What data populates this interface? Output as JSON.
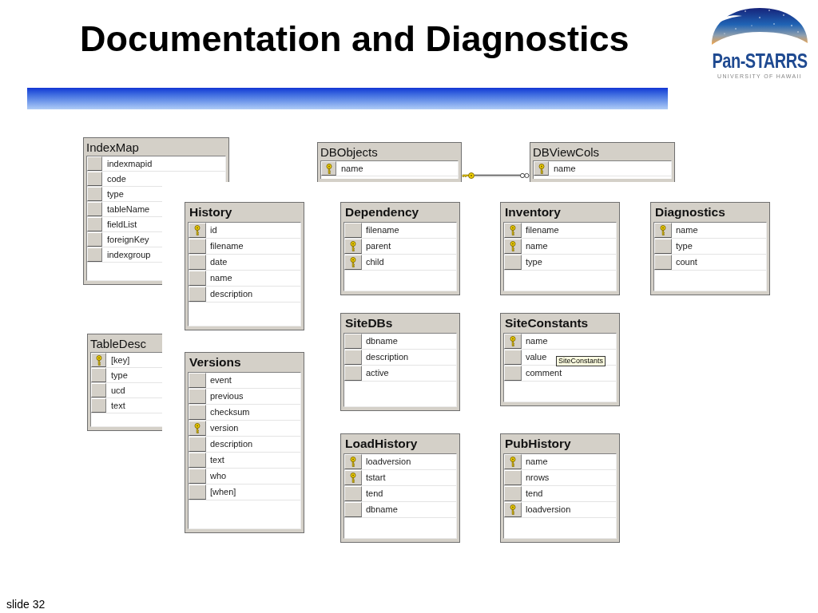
{
  "slide": {
    "title": "Documentation and Diagnostics",
    "footer": "slide 32"
  },
  "logo": {
    "wordmark": "Pan-STARRS",
    "subtitle": "UNIVERSITY OF HAWAII"
  },
  "diagram": {
    "tables": [
      {
        "name": "IndexMap",
        "kind": "plain",
        "columns": [
          {
            "name": "indexmapid",
            "key": false
          },
          {
            "name": "code",
            "key": false
          },
          {
            "name": "type",
            "key": false
          },
          {
            "name": "tableName",
            "key": false
          },
          {
            "name": "fieldList",
            "key": false
          },
          {
            "name": "foreignKey",
            "key": false
          },
          {
            "name": "indexgroup",
            "key": false
          }
        ]
      },
      {
        "name": "DBObjects",
        "kind": "plain",
        "columns": [
          {
            "name": "name",
            "key": true
          }
        ]
      },
      {
        "name": "DBViewCols",
        "kind": "plain",
        "columns": [
          {
            "name": "name",
            "key": true
          }
        ]
      },
      {
        "name": "History",
        "kind": "bold",
        "columns": [
          {
            "name": "id",
            "key": true
          },
          {
            "name": "filename",
            "key": false
          },
          {
            "name": "date",
            "key": false
          },
          {
            "name": "name",
            "key": false
          },
          {
            "name": "description",
            "key": false
          }
        ]
      },
      {
        "name": "Dependency",
        "kind": "bold",
        "columns": [
          {
            "name": "filename",
            "key": false
          },
          {
            "name": "parent",
            "key": true
          },
          {
            "name": "child",
            "key": true
          }
        ]
      },
      {
        "name": "Inventory",
        "kind": "bold",
        "columns": [
          {
            "name": "filename",
            "key": true
          },
          {
            "name": "name",
            "key": true
          },
          {
            "name": "type",
            "key": false
          }
        ]
      },
      {
        "name": "Diagnostics",
        "kind": "bold",
        "columns": [
          {
            "name": "name",
            "key": true
          },
          {
            "name": "type",
            "key": false
          },
          {
            "name": "count",
            "key": false
          }
        ]
      },
      {
        "name": "SiteDBs",
        "kind": "bold",
        "columns": [
          {
            "name": "dbname",
            "key": false
          },
          {
            "name": "description",
            "key": false
          },
          {
            "name": "active",
            "key": false
          }
        ]
      },
      {
        "name": "SiteConstants",
        "kind": "bold",
        "tooltip": "SiteConstants",
        "columns": [
          {
            "name": "name",
            "key": true
          },
          {
            "name": "value",
            "key": false
          },
          {
            "name": "comment",
            "key": false
          }
        ]
      },
      {
        "name": "TableDesc",
        "kind": "plain",
        "columns": [
          {
            "name": "[key]",
            "key": true
          },
          {
            "name": "type",
            "key": false
          },
          {
            "name": "ucd",
            "key": false
          },
          {
            "name": "text",
            "key": false
          }
        ]
      },
      {
        "name": "Versions",
        "kind": "bold",
        "columns": [
          {
            "name": "event",
            "key": false
          },
          {
            "name": "previous",
            "key": false
          },
          {
            "name": "checksum",
            "key": false
          },
          {
            "name": "version",
            "key": true
          },
          {
            "name": "description",
            "key": false
          },
          {
            "name": "text",
            "key": false
          },
          {
            "name": "who",
            "key": false
          },
          {
            "name": "[when]",
            "key": false
          }
        ]
      },
      {
        "name": "LoadHistory",
        "kind": "bold",
        "columns": [
          {
            "name": "loadversion",
            "key": true
          },
          {
            "name": "tstart",
            "key": true
          },
          {
            "name": "tend",
            "key": false
          },
          {
            "name": "dbname",
            "key": false
          }
        ]
      },
      {
        "name": "PubHistory",
        "kind": "bold",
        "columns": [
          {
            "name": "name",
            "key": true
          },
          {
            "name": "nrows",
            "key": false
          },
          {
            "name": "tend",
            "key": false
          },
          {
            "name": "loadversion",
            "key": true
          }
        ]
      }
    ]
  }
}
